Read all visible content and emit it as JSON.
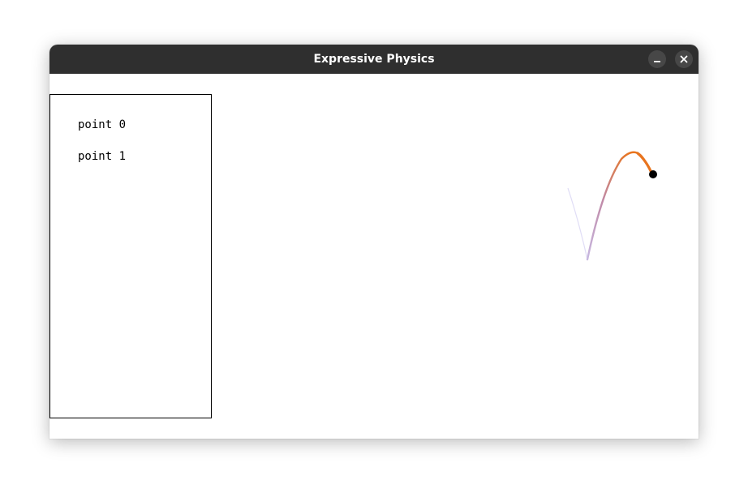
{
  "window": {
    "title": "Expressive Physics"
  },
  "titlebar_buttons": [
    {
      "name": "minimize",
      "icon": "minimize-icon"
    },
    {
      "name": "close",
      "icon": "close-icon"
    }
  ],
  "point_list": {
    "items": [
      {
        "label": "point 0"
      },
      {
        "label": "point 1"
      }
    ]
  },
  "simulation": {
    "trail_colors": {
      "start": "#c9c4f0",
      "mid": "#c08aa8",
      "end": "#e8741e"
    },
    "body_color": "#000000"
  }
}
